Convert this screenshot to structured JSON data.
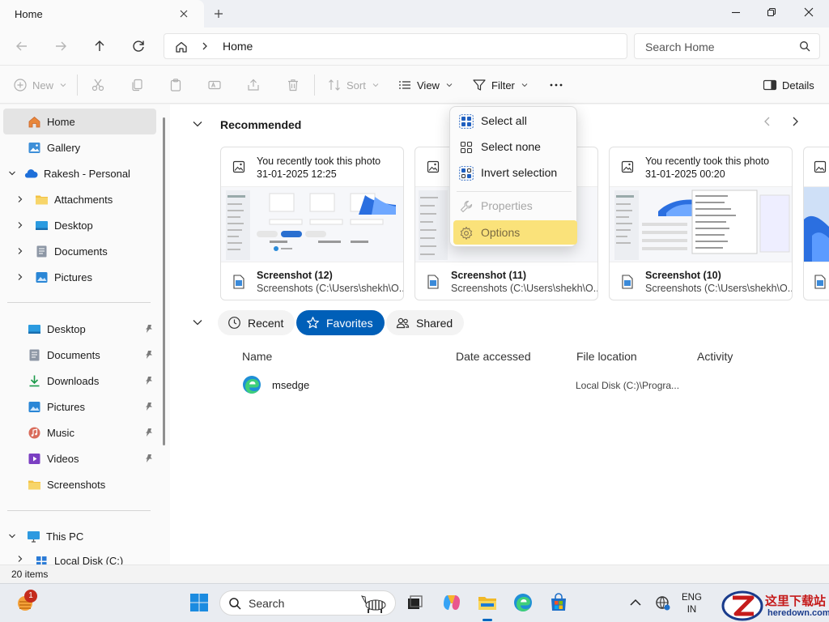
{
  "window": {
    "tab_title": "Home",
    "breadcrumb": "Home",
    "search_placeholder": "Search Home"
  },
  "toolbar": {
    "new_label": "New",
    "sort_label": "Sort",
    "view_label": "View",
    "filter_label": "Filter",
    "details_label": "Details"
  },
  "sidebar": {
    "home": "Home",
    "gallery": "Gallery",
    "onedrive": "Rakesh - Personal",
    "onedrive_children": [
      "Attachments",
      "Desktop",
      "Documents",
      "Pictures"
    ],
    "quick_access": [
      "Desktop",
      "Documents",
      "Downloads",
      "Pictures",
      "Music",
      "Videos",
      "Screenshots"
    ],
    "this_pc": "This PC",
    "local_disk": "Local Disk (C:)"
  },
  "recommended": {
    "title": "Recommended",
    "cards": [
      {
        "line1": "You recently took this photo",
        "line2": "31-01-2025 12:25",
        "name": "Screenshot (12)",
        "path": "Screenshots (C:\\Users\\shekh\\O..."
      },
      {
        "line1": "",
        "line2": "",
        "name": "Screenshot (11)",
        "path": "Screenshots (C:\\Users\\shekh\\O..."
      },
      {
        "line1": "You recently took this photo",
        "line2": "31-01-2025 00:20",
        "name": "Screenshot (10)",
        "path": "Screenshots (C:\\Users\\shekh\\O..."
      }
    ]
  },
  "tabs": {
    "recent": "Recent",
    "favorites": "Favorites",
    "shared": "Shared",
    "selected": "Favorites"
  },
  "columns": {
    "name": "Name",
    "date_accessed": "Date accessed",
    "file_location": "File location",
    "activity": "Activity"
  },
  "rows": [
    {
      "name": "msedge",
      "date_accessed": "",
      "location": "Local Disk (C:)\\Progra...",
      "activity": ""
    }
  ],
  "menu": {
    "select_all": "Select all",
    "select_none": "Select none",
    "invert_selection": "Invert selection",
    "properties": "Properties",
    "options": "Options",
    "highlighted": "Options"
  },
  "status": {
    "item_count": "20 items"
  },
  "taskbar": {
    "search_label": "Search",
    "lang_line1": "ENG",
    "lang_line2": "IN",
    "widgets_badge": "1"
  },
  "watermark": {
    "cn": "这里下载站",
    "domain": "heredown.com"
  },
  "colors": {
    "accent": "#005fb8",
    "highlight": "#fae27a",
    "folder": "#f3c244"
  }
}
